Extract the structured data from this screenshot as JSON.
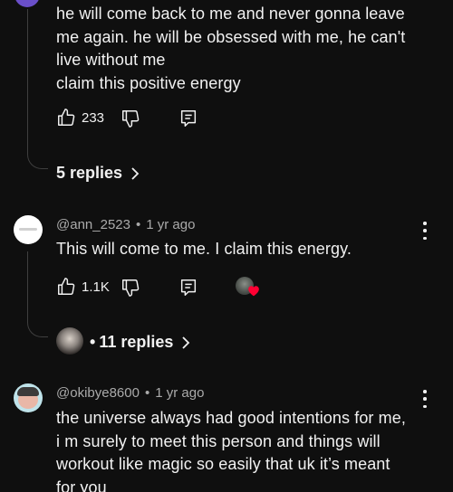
{
  "comment1": {
    "text_lines": [
      "he will come back to me and never gonna leave",
      "me again. he will be obsessed with me, he can't",
      "live without me",
      "claim this positive energy"
    ],
    "likes": "233",
    "replies_label": "5 replies"
  },
  "comment2": {
    "author": "@ann_2523",
    "time": "1 yr ago",
    "text": "This will come to me. I claim this energy.",
    "likes": "1.1K",
    "replies_label": "11 replies",
    "replies_prefix": "•"
  },
  "comment3": {
    "author": "@okibye8600",
    "time": "1 yr ago",
    "text_lines": [
      "the universe always had good intentions for me,",
      "i m surely to meet this person and things will",
      "workout like magic so easily that uk it’s meant",
      "for you"
    ]
  },
  "colors": {
    "background": "#0f0f0f",
    "text": "#f1f1f1",
    "meta": "#aaaaaa",
    "heart": "#ff0033",
    "thread": "#3f3f3f"
  },
  "icons": [
    "like-icon",
    "dislike-icon",
    "reply-icon",
    "chevron-right-icon",
    "more-vert-icon",
    "heart-icon"
  ]
}
